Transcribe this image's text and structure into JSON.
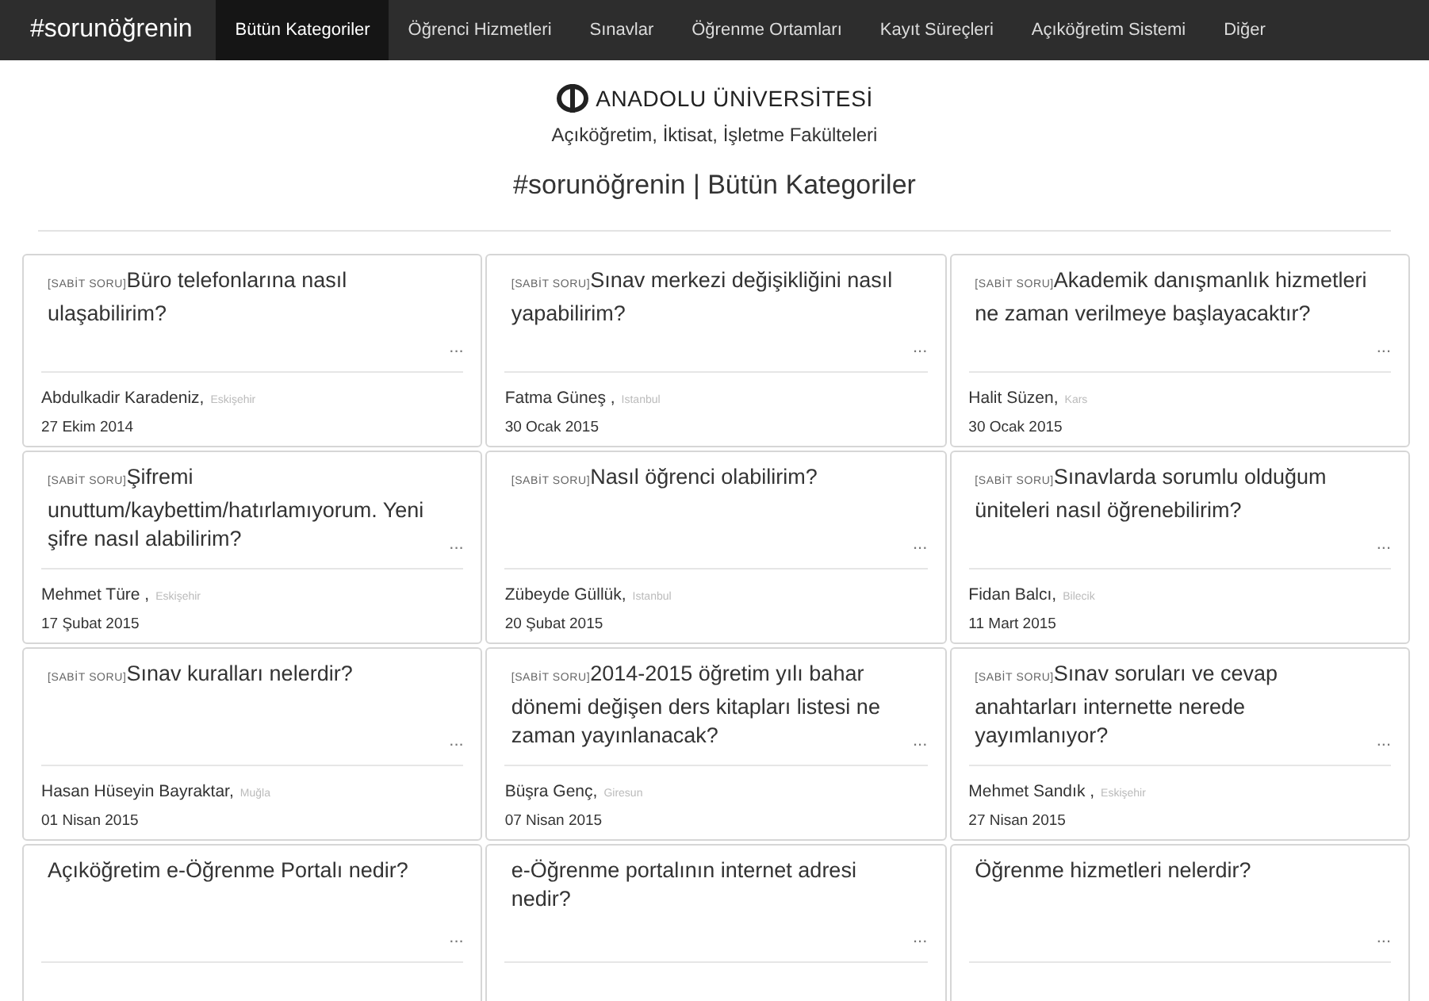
{
  "navbar": {
    "brand": "#sorunöğrenin",
    "items": [
      {
        "label": "Bütün Kategoriler",
        "selected": true
      },
      {
        "label": "Öğrenci Hizmetleri",
        "selected": false
      },
      {
        "label": "Sınavlar",
        "selected": false
      },
      {
        "label": "Öğrenme Ortamları",
        "selected": false
      },
      {
        "label": "Kayıt Süreçleri",
        "selected": false
      },
      {
        "label": "Açıköğretim Sistemi",
        "selected": false
      },
      {
        "label": "Diğer",
        "selected": false
      }
    ]
  },
  "header": {
    "logo_text": "ANADOLU ÜNİVERSİTESİ",
    "subtitle": "Açıköğretim, İktisat, İşletme Fakülteleri",
    "title": "#sorunöğrenin | Bütün Kategoriler"
  },
  "cards": [
    {
      "tag": "[SABİT SORU]",
      "question": "Büro telefonlarına nasıl ulaşabilirim?",
      "more": "...",
      "author": "Abdulkadir Karadeniz,",
      "city": "Eskişehir",
      "date": "27 Ekim 2014"
    },
    {
      "tag": "[SABİT SORU]",
      "question": "Sınav merkezi değişikliğini nasıl yapabilirim?",
      "more": "...",
      "author": "Fatma Güneş ,",
      "city": "Istanbul",
      "date": "30 Ocak 2015"
    },
    {
      "tag": "[SABİT SORU]",
      "question": "Akademik danışmanlık hizmetleri ne zaman verilmeye başlayacaktır?",
      "more": "...",
      "author": "Halit Süzen,",
      "city": "Kars",
      "date": "30 Ocak 2015"
    },
    {
      "tag": "[SABİT SORU]",
      "question": "Şifremi unuttum/kaybettim/hatırlamıyorum. Yeni şifre nasıl alabilirim?",
      "more": "...",
      "author": "Mehmet Türe ,",
      "city": "Eskişehir",
      "date": "17 Şubat 2015"
    },
    {
      "tag": "[SABİT SORU]",
      "question": "Nasıl öğrenci olabilirim?",
      "more": "...",
      "author": "Zübeyde Güllük,",
      "city": "Istanbul",
      "date": "20 Şubat 2015"
    },
    {
      "tag": "[SABİT SORU]",
      "question": "Sınavlarda sorumlu olduğum üniteleri nasıl öğrenebilirim?",
      "more": "...",
      "author": "Fidan Balcı,",
      "city": "Bilecik",
      "date": "11 Mart 2015"
    },
    {
      "tag": "[SABİT SORU]",
      "question": "Sınav kuralları nelerdir?",
      "more": "...",
      "author": "Hasan Hüseyin Bayraktar,",
      "city": "Muğla",
      "date": "01 Nisan 2015"
    },
    {
      "tag": "[SABİT SORU]",
      "question": "2014-2015 öğretim yılı bahar dönemi değişen ders kitapları listesi ne zaman yayınlanacak?",
      "more": "...",
      "author": "Büşra Genç,",
      "city": "Giresun",
      "date": "07 Nisan 2015"
    },
    {
      "tag": "[SABİT SORU]",
      "question": "Sınav soruları ve cevap anahtarları internette nerede yayımlanıyor?",
      "more": "...",
      "author": "Mehmet Sandık ,",
      "city": "Eskişehir",
      "date": "27 Nisan 2015"
    },
    {
      "question": "Açıköğretim e-Öğrenme Portalı nedir?",
      "more": "..."
    },
    {
      "question": "e-Öğrenme portalının internet adresi nedir?",
      "more": "..."
    },
    {
      "question": "Öğrenme hizmetleri nelerdir?",
      "more": "..."
    }
  ]
}
